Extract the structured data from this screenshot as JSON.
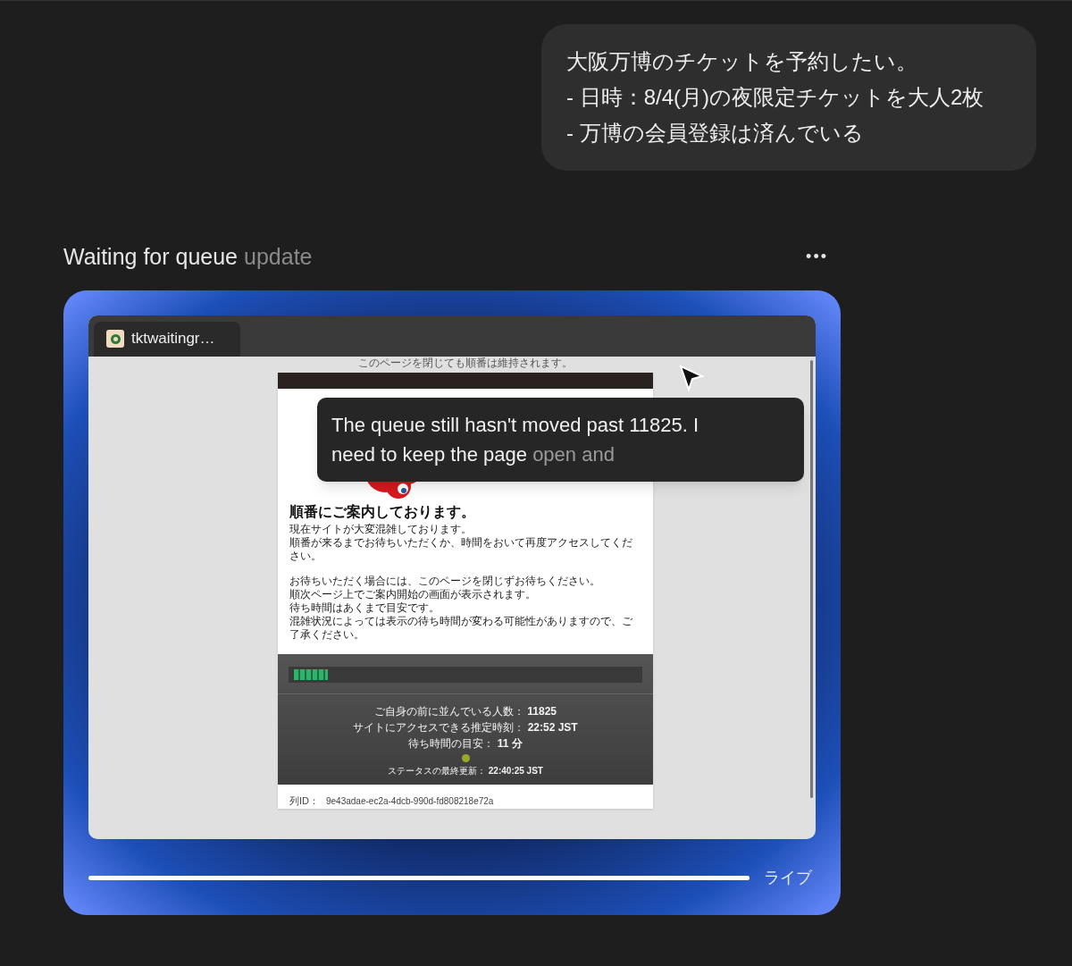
{
  "message": {
    "lines": [
      "大阪万博のチケットを予約したい。",
      "- 日時：8/4(月)の夜限定チケットを大人2枚",
      "- 万博の会員登録は済んでいる"
    ]
  },
  "task": {
    "title": [
      {
        "text": "Waiting for queue ",
        "faded": false
      },
      {
        "text": "update",
        "faded": true
      }
    ],
    "menu": "•••"
  },
  "browser": {
    "tab": {
      "label": "tktwaitingr…"
    },
    "page": {
      "top_note": "このページを閉じても順番は維持されます。",
      "heading": "順番にご案内しております。",
      "paragraphs": [
        [
          "現在サイトが大変混雑しております。",
          "順番が来るまでお待ちいただくか、時間をおいて再度アクセスしてください。"
        ],
        [
          "お待ちいただく場合には、このページを閉じずお待ちください。",
          "順次ページ上でご案内開始の画面が表示されます。",
          "待ち時間はあくまで目安です。",
          "混雑状況によっては表示の待ち時間が変わる可能性がありますので、ご了承ください。"
        ]
      ],
      "progress": {
        "level": 0.1
      },
      "status_lines": [
        {
          "label": "ご自身の前に並んでいる人数：",
          "value": "11825"
        },
        {
          "label": "サイトにアクセスできる推定時刻：",
          "value": "22:52 JST"
        },
        {
          "label": "待ち時間の目安：",
          "value": "11 分"
        }
      ],
      "status_dot": {
        "color": "#9aa82a"
      },
      "last_update": {
        "label": "ステータスの最終更新：",
        "value": "22:40:25 JST"
      },
      "queue_id": {
        "label": "列ID：",
        "value": "9e43adae-ec2a-4dcb-990d-fd808218e72a"
      }
    }
  },
  "thought": {
    "lines": [
      [
        {
          "text": "The queue still hasn't moved past 11825. I",
          "faded": false
        }
      ],
      [
        {
          "text": "need to keep the page",
          "faded": false
        },
        {
          "text": "open and",
          "faded": true
        }
      ]
    ]
  },
  "playback": {
    "level": 1.0,
    "label": "ライブ"
  }
}
